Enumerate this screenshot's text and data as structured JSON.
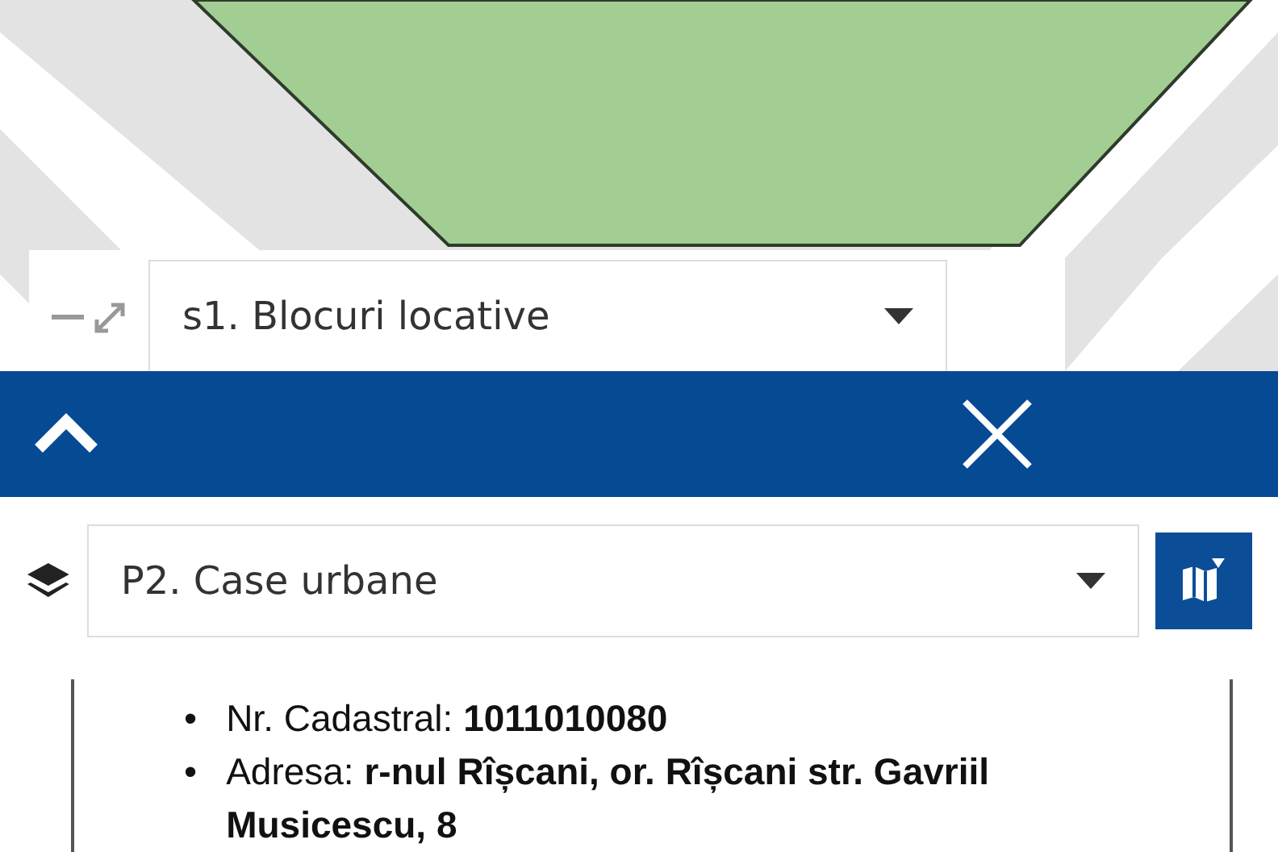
{
  "map_panel": {
    "layer": "s1. Blocuri locative"
  },
  "layer_select": {
    "value": "P2. Case urbane"
  },
  "details": [
    {
      "bullet": "•",
      "text": "Nr. Cadastral: **1011010080**"
    },
    {
      "bullet": "•",
      "text": "Adresa: **r-nul Rîșcani, or. Rîșcani str. Gavriil Musicescu, 8**"
    }
  ]
}
